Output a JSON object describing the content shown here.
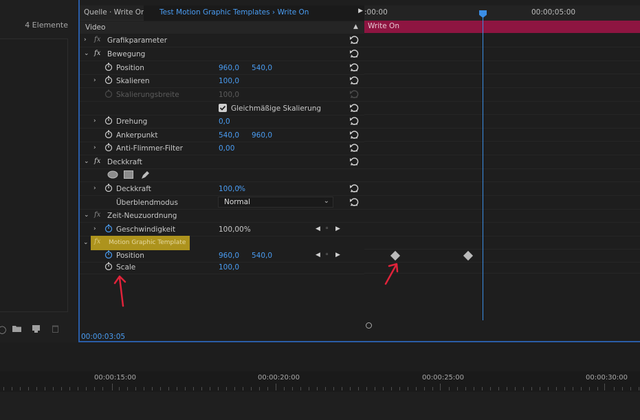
{
  "project_panel": {
    "elements_count": "4 Elemente"
  },
  "effect_controls": {
    "source_tab": "Quelle · Write On",
    "clip_name": "Test Motion Graphic Templates › Write On",
    "section_video": "Video",
    "effects": {
      "grafikparameter": "Grafikparameter",
      "bewegung": "Bewegung",
      "position": "Position",
      "position_x": "960,0",
      "position_y": "540,0",
      "skalieren": "Skalieren",
      "skalieren_val": "100,0",
      "skalierungsbreite": "Skalierungsbreite",
      "skalierungsbreite_val": "100,0",
      "gleichmaessige": "Gleichmäßige Skalierung",
      "drehung": "Drehung",
      "drehung_val": "0,0",
      "ankerpunkt": "Ankerpunkt",
      "ankerpunkt_x": "540,0",
      "ankerpunkt_y": "960,0",
      "anti_flimmer": "Anti-Flimmer-Filter",
      "anti_flimmer_val": "0,00",
      "deckkraft_group": "Deckkraft",
      "deckkraft": "Deckkraft",
      "deckkraft_val": "100,0",
      "deckkraft_unit": "%",
      "ueberblendmodus": "Überblendmodus",
      "ueberblendmodus_val": "Normal",
      "zeit_neuzuordnung": "Zeit-Neuzuordnung",
      "geschwindigkeit": "Geschwindigkeit",
      "geschwindigkeit_val": "100,00%",
      "mgt": "Motion Graphic Template",
      "mgt_position": "Position",
      "mgt_position_x": "960,0",
      "mgt_position_y": "540,0",
      "mgt_scale": "Scale",
      "mgt_scale_val": "100,0"
    },
    "current_time": "00:00:03:05"
  },
  "mini_timeline": {
    "start_tc": ":00:00",
    "mid_tc": "00:00;05:00",
    "clip_label": "Write On"
  },
  "sequence_timeline": {
    "timecodes": [
      "00:00:15:00",
      "00:00:20:00",
      "00:00:25:00",
      "00:00:30:00"
    ]
  },
  "colors": {
    "accent_blue": "#4a9df3",
    "clip_bar": "#8e1541",
    "mgt_badge": "#b59a1d",
    "annotation_red": "#e0233a"
  }
}
